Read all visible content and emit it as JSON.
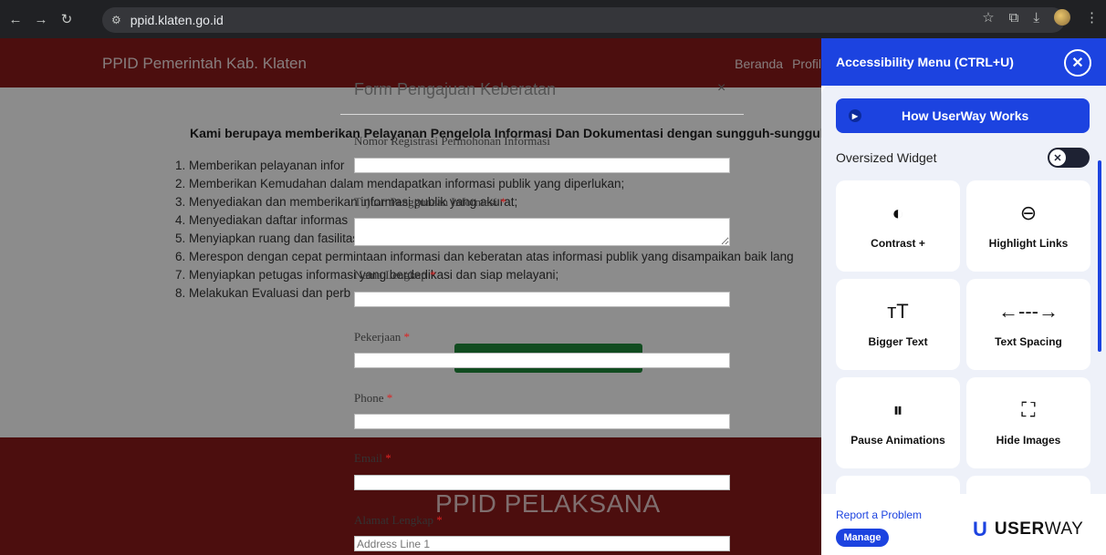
{
  "browser": {
    "url": "ppid.klaten.go.id",
    "icons": [
      "back-arrow",
      "forward-arrow",
      "reload",
      "site-info",
      "star",
      "extensions",
      "download",
      "profile",
      "more-menu"
    ]
  },
  "site": {
    "brand": "PPID Pemerintah Kab. Klaten",
    "nav": [
      "Beranda",
      "Profil"
    ],
    "intro": "Kami berupaya memberikan Pelayanan Pengelola Informasi Dan Dokumentasi dengan sungguh-sungguh",
    "list": [
      "1. Memberikan pelayanan infor",
      "2. Memberikan Kemudahan dalam mendapatkan informasi publik yang diperlukan;",
      "3. Menyediakan dan memberikan informasi publik yang akurat;",
      "4. Menyediakan daftar informas",
      "5. Menyiapkan ruang dan fasilitas yang nyaman;",
      "6. Merespon dengan cepat permintaan informasi dan keberatan atas informasi publik yang disampaikan baik lang",
      "7. Menyiapkan petugas informasi yang berdedikasi dan siap melayani;",
      "8. Melakukan Evaluasi dan perb"
    ],
    "footer_title": "PPID PELAKSANA"
  },
  "modal": {
    "title": "Form Pengajuan Keberatan",
    "close": "×",
    "fields": {
      "nomor": {
        "label": "Nomor Registrasi Permohonan Informasi",
        "required": ""
      },
      "tujuan": {
        "label": "Tujuan Penggunaan Informasi",
        "required": "*"
      },
      "nama": {
        "label": "Nama Lengkap",
        "required": "*"
      },
      "pekerjaan": {
        "label": "Pekerjaan",
        "required": "*"
      },
      "phone": {
        "label": "Phone",
        "required": "*"
      },
      "email": {
        "label": "Email",
        "required": "*"
      },
      "alamat": {
        "label": "Alamat Lengkap",
        "required": "*",
        "placeholder": "Address Line 1"
      }
    }
  },
  "accessibility": {
    "title": "Accessibility Menu (CTRL+U)",
    "close": "✕",
    "how_label": "How UserWay Works",
    "oversized_label": "Oversized Widget",
    "cards": [
      {
        "label": "Contrast +",
        "icon": "contrast-icon"
      },
      {
        "label": "Highlight Links",
        "icon": "link-icon"
      },
      {
        "label": "Bigger Text",
        "icon": "text-size-icon"
      },
      {
        "label": "Text Spacing",
        "icon": "text-spacing-icon"
      },
      {
        "label": "Pause Animations",
        "icon": "pause-icon"
      },
      {
        "label": "Hide Images",
        "icon": "hide-image-icon"
      }
    ],
    "report_label": "Report a Problem",
    "manage_label": "Manage",
    "brand_bold": "USER",
    "brand_rest": "WAY"
  },
  "colors": {
    "maroon": "#8b1a1a",
    "userway_blue": "#1c43e0",
    "green": "#1f8a3b"
  }
}
